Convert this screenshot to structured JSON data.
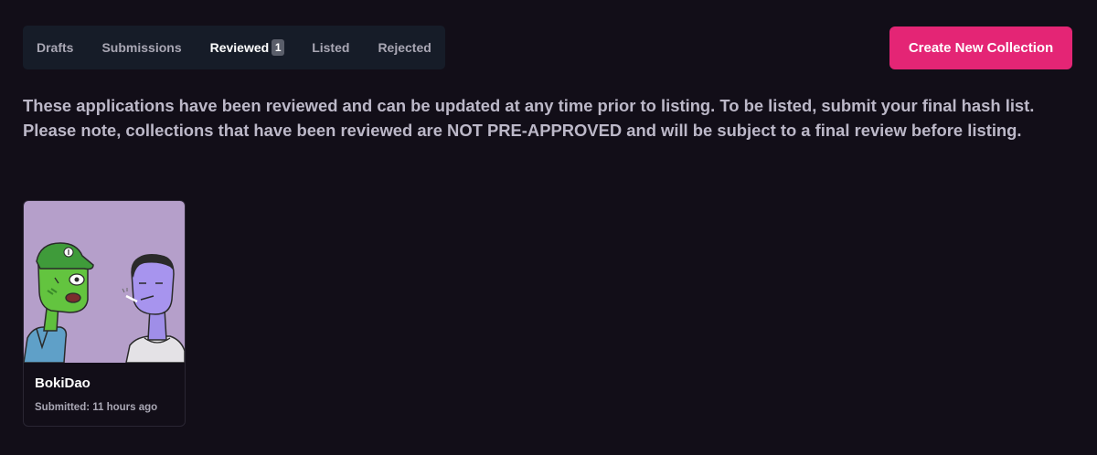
{
  "tabs": [
    {
      "label": "Drafts",
      "active": false
    },
    {
      "label": "Submissions",
      "active": false
    },
    {
      "label": "Reviewed",
      "active": true,
      "badge": "1"
    },
    {
      "label": "Listed",
      "active": false
    },
    {
      "label": "Rejected",
      "active": false
    }
  ],
  "header": {
    "create_button_label": "Create New Collection"
  },
  "description": "These applications have been reviewed and can be updated at any time prior to listing. To be listed, submit your final hash list. Please note, collections that have been reviewed are NOT PRE-APPROVED and will be subject to a final review before listing.",
  "collections": [
    {
      "name": "BokiDao",
      "submitted": "Submitted: 11 hours ago",
      "image_icon": "collection-artwork"
    }
  ],
  "colors": {
    "background": "#120e18",
    "tab_bar": "#161c28",
    "accent": "#e42575",
    "text_muted": "#a9a7b4"
  }
}
